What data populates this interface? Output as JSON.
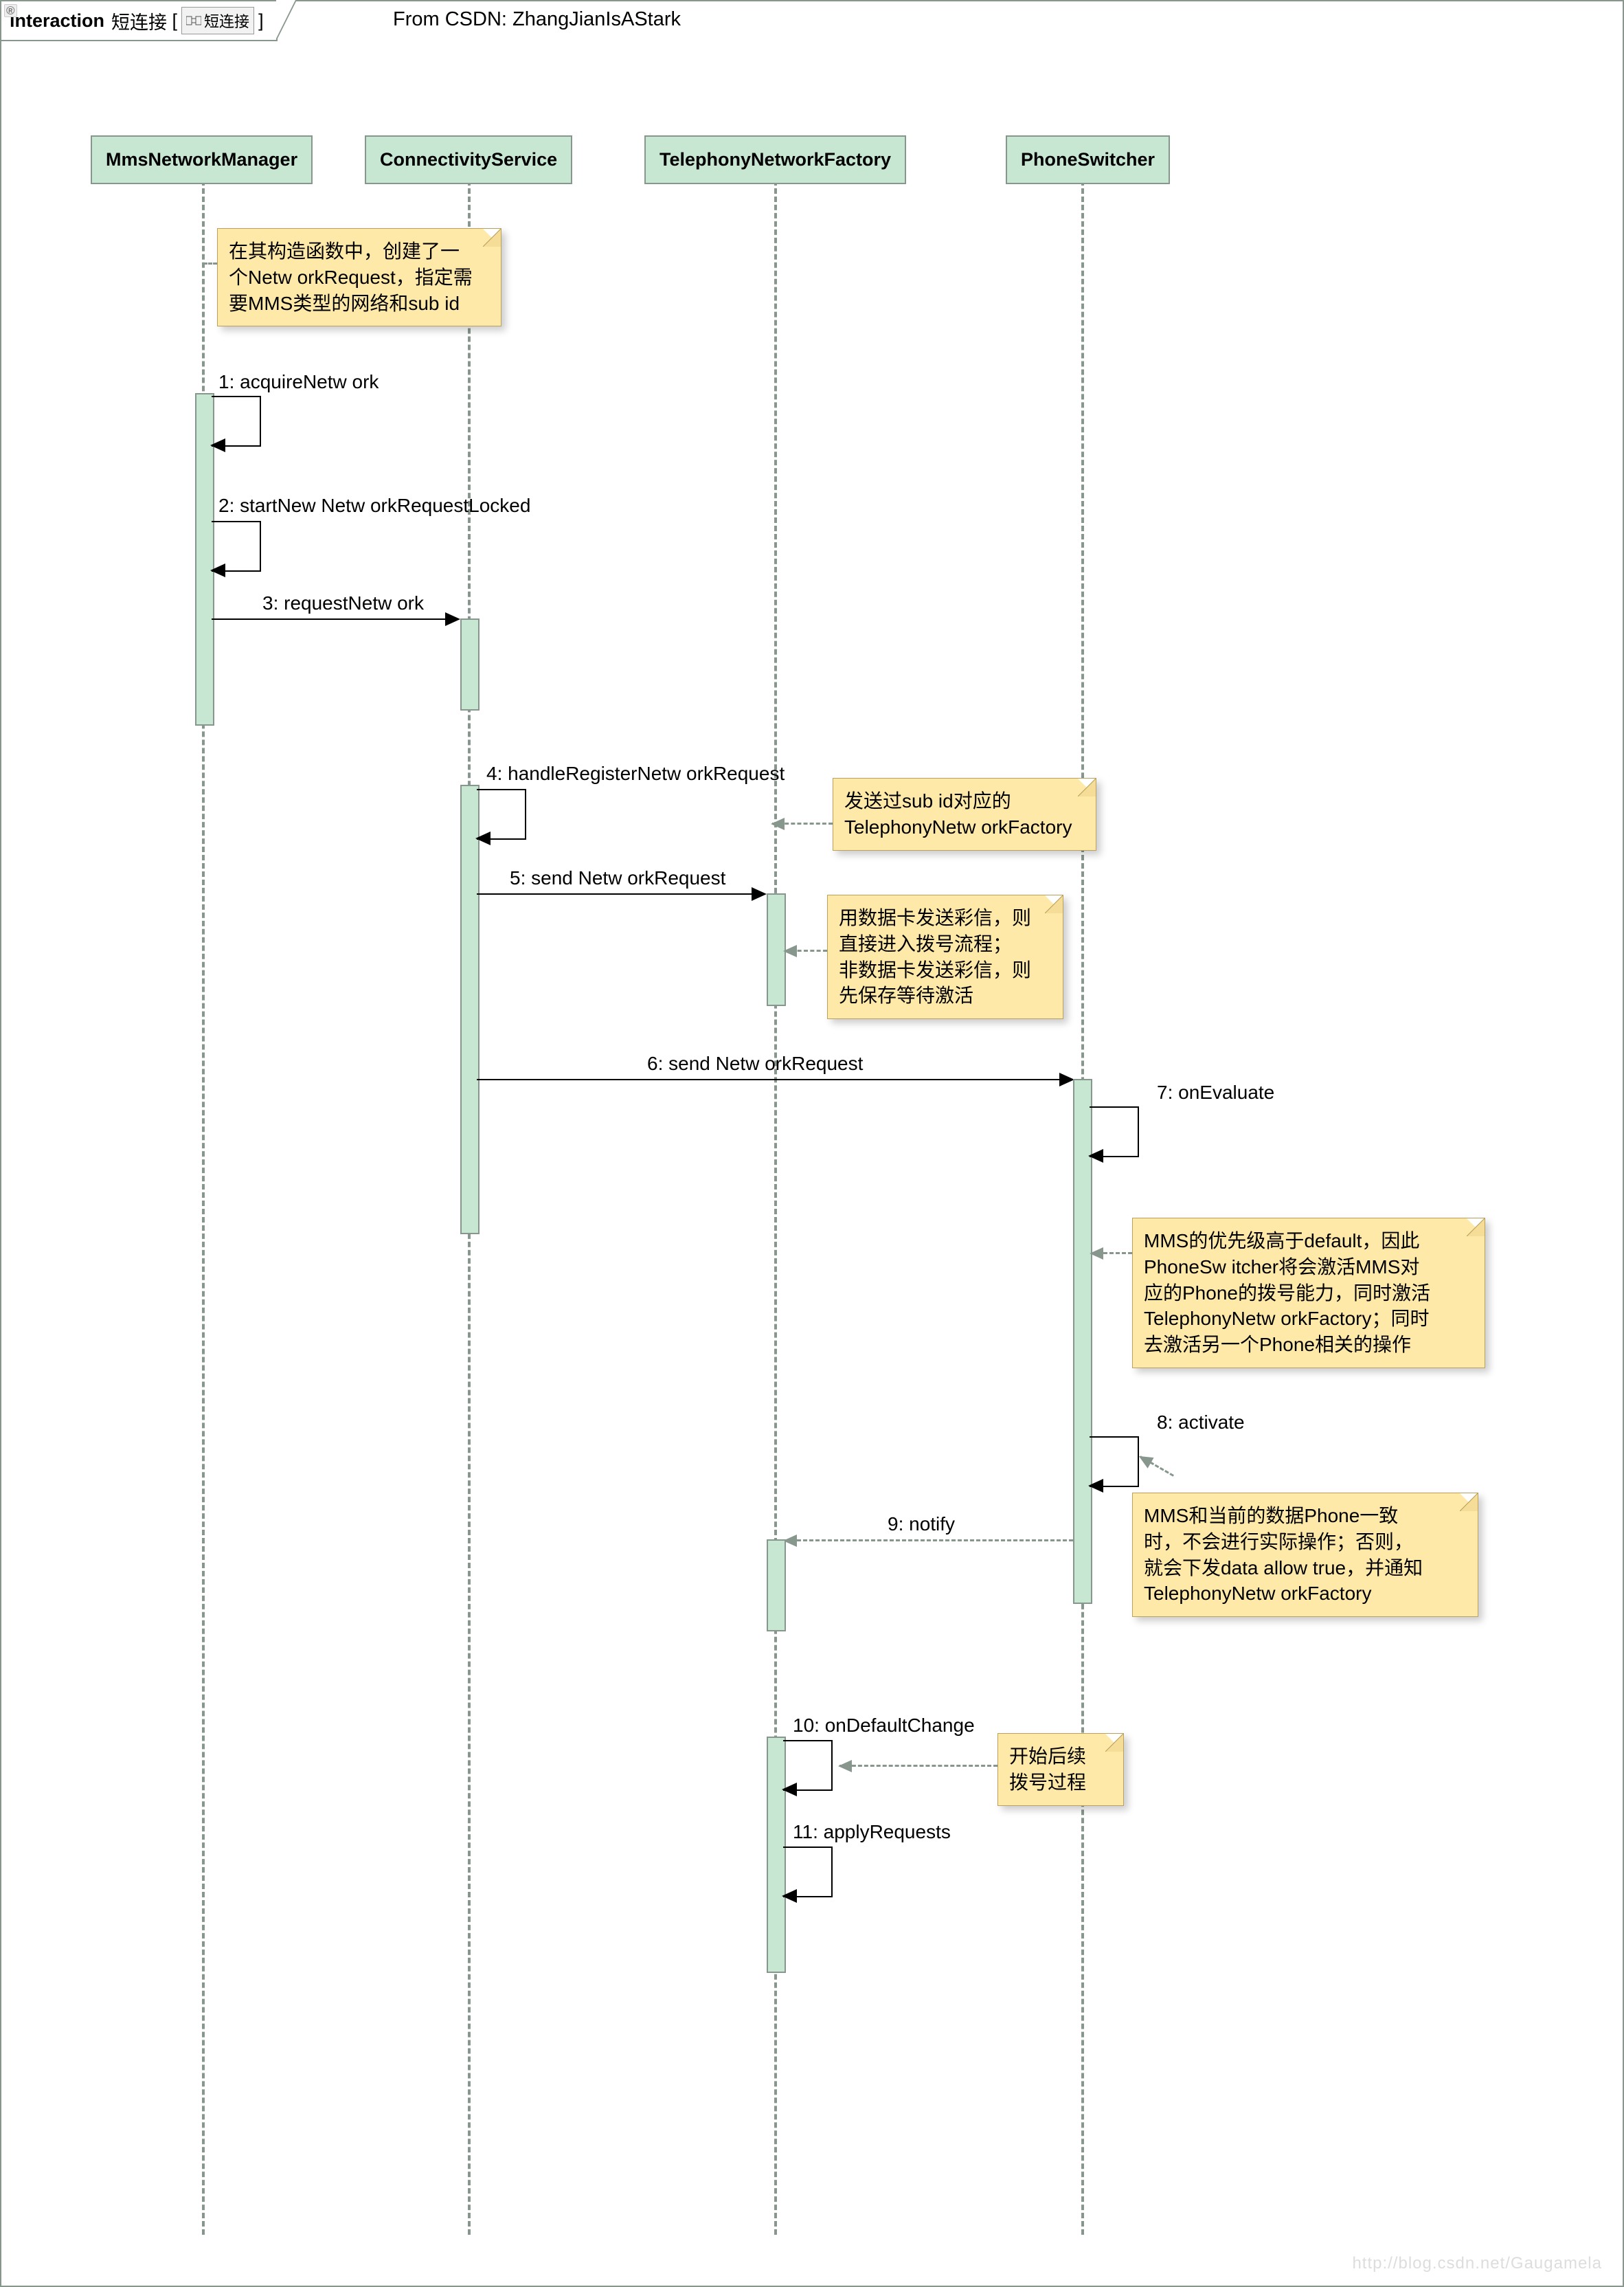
{
  "title_prefix": "interaction",
  "title_main": "短连接",
  "title_bracket": "短连接",
  "credit": "From CSDN: ZhangJianIsAStark",
  "actors": {
    "a1": "MmsNetworkManager",
    "a2": "ConnectivityService",
    "a3": "TelephonyNetworkFactory",
    "a4": "PhoneSwitcher"
  },
  "messages": {
    "m1": "1: acquireNetw ork",
    "m2": "2: startNew Netw orkRequestLocked",
    "m3": "3: requestNetw ork",
    "m4": "4: handleRegisterNetw orkRequest",
    "m5": "5: send Netw orkRequest",
    "m6": "6: send Netw orkRequest",
    "m7": "7: onEvaluate",
    "m8": "8: activate",
    "m9": "9: notify",
    "m10": "10: onDefaultChange",
    "m11": "11: applyRequests"
  },
  "notes": {
    "n1": "在其构造函数中，创建了一\n个Netw orkRequest，指定需\n要MMS类型的网络和sub id",
    "n2": "发送过sub id对应的\nTelephonyNetw orkFactory",
    "n3": "用数据卡发送彩信，则\n直接进入拨号流程；\n非数据卡发送彩信，则\n先保存等待激活",
    "n4": "MMS的优先级高于default，因此\nPhoneSw itcher将会激活MMS对\n应的Phone的拨号能力，同时激活\nTelephonyNetw orkFactory；同时\n去激活另一个Phone相关的操作",
    "n5": "MMS和当前的数据Phone一致\n时，不会进行实际操作；否则，\n就会下发data allow true，并通知\nTelephonyNetw orkFactory",
    "n6": "开始后续\n拨号过程"
  },
  "watermark": "http://blog.csdn.net/Gaugamela"
}
